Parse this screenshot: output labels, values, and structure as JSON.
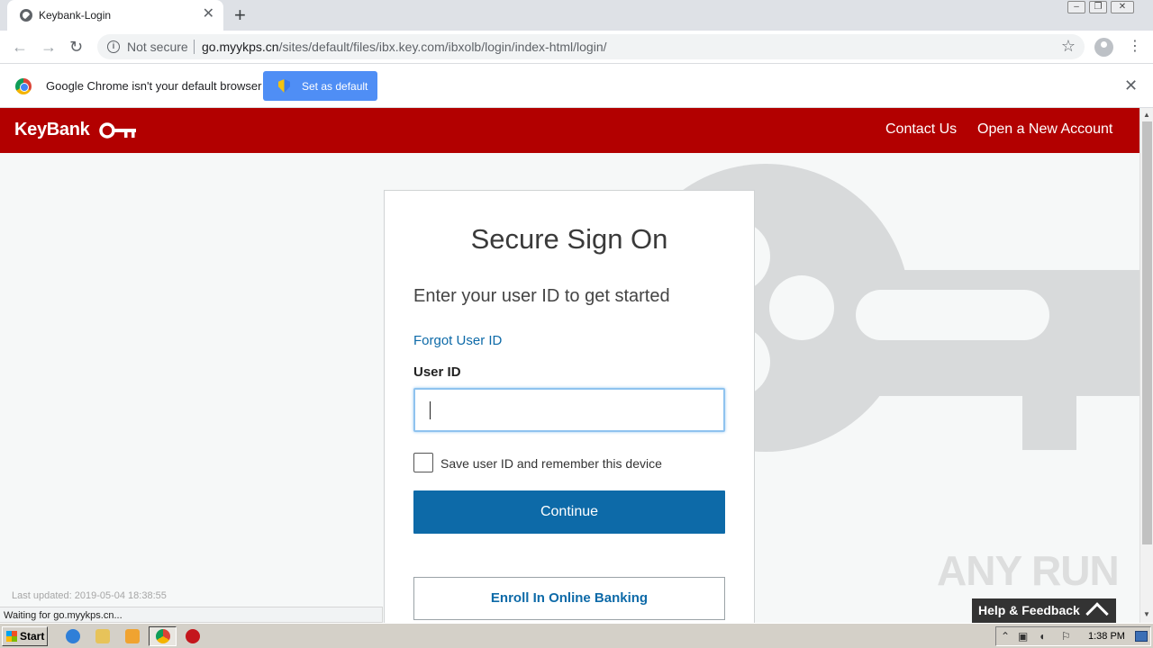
{
  "browser": {
    "tab_title": "Keybank-Login",
    "tab_close": "✕",
    "new_tab": "+",
    "security_label": "Not secure",
    "url_host": "go.myykps.cn",
    "url_path": "/sites/default/files/ibx.key.com/ibxolb/login/index-html/login/",
    "back": "←",
    "forward": "→",
    "reload": "↻",
    "bookmark_star": "☆",
    "menu": "⋮"
  },
  "infobar": {
    "message": "Google Chrome isn't your default browser",
    "button_label": "Set as default",
    "close": "✕"
  },
  "site": {
    "brand": "KeyBank",
    "nav": [
      "Contact Us",
      "Open a New Account"
    ],
    "brand_color": "#b20000",
    "accent_color": "#0d6aa8"
  },
  "signon": {
    "heading": "Secure Sign On",
    "subheading": "Enter your user ID to get started",
    "forgot_link": "Forgot User ID",
    "userid_label": "User ID",
    "userid_value": "",
    "remember_label": "Save user ID and remember this device",
    "remember_checked": false,
    "continue_label": "Continue",
    "enroll_label": "Enroll In Online Banking"
  },
  "footer": {
    "last_updated": "Last updated: 2019-05-04 18:38:55",
    "watermark": "ANY RUN",
    "help_feedback": "Help & Feedback"
  },
  "status_bar": "Waiting for go.myykps.cn...",
  "taskbar": {
    "start_label": "Start",
    "clock": "1:38 PM"
  }
}
